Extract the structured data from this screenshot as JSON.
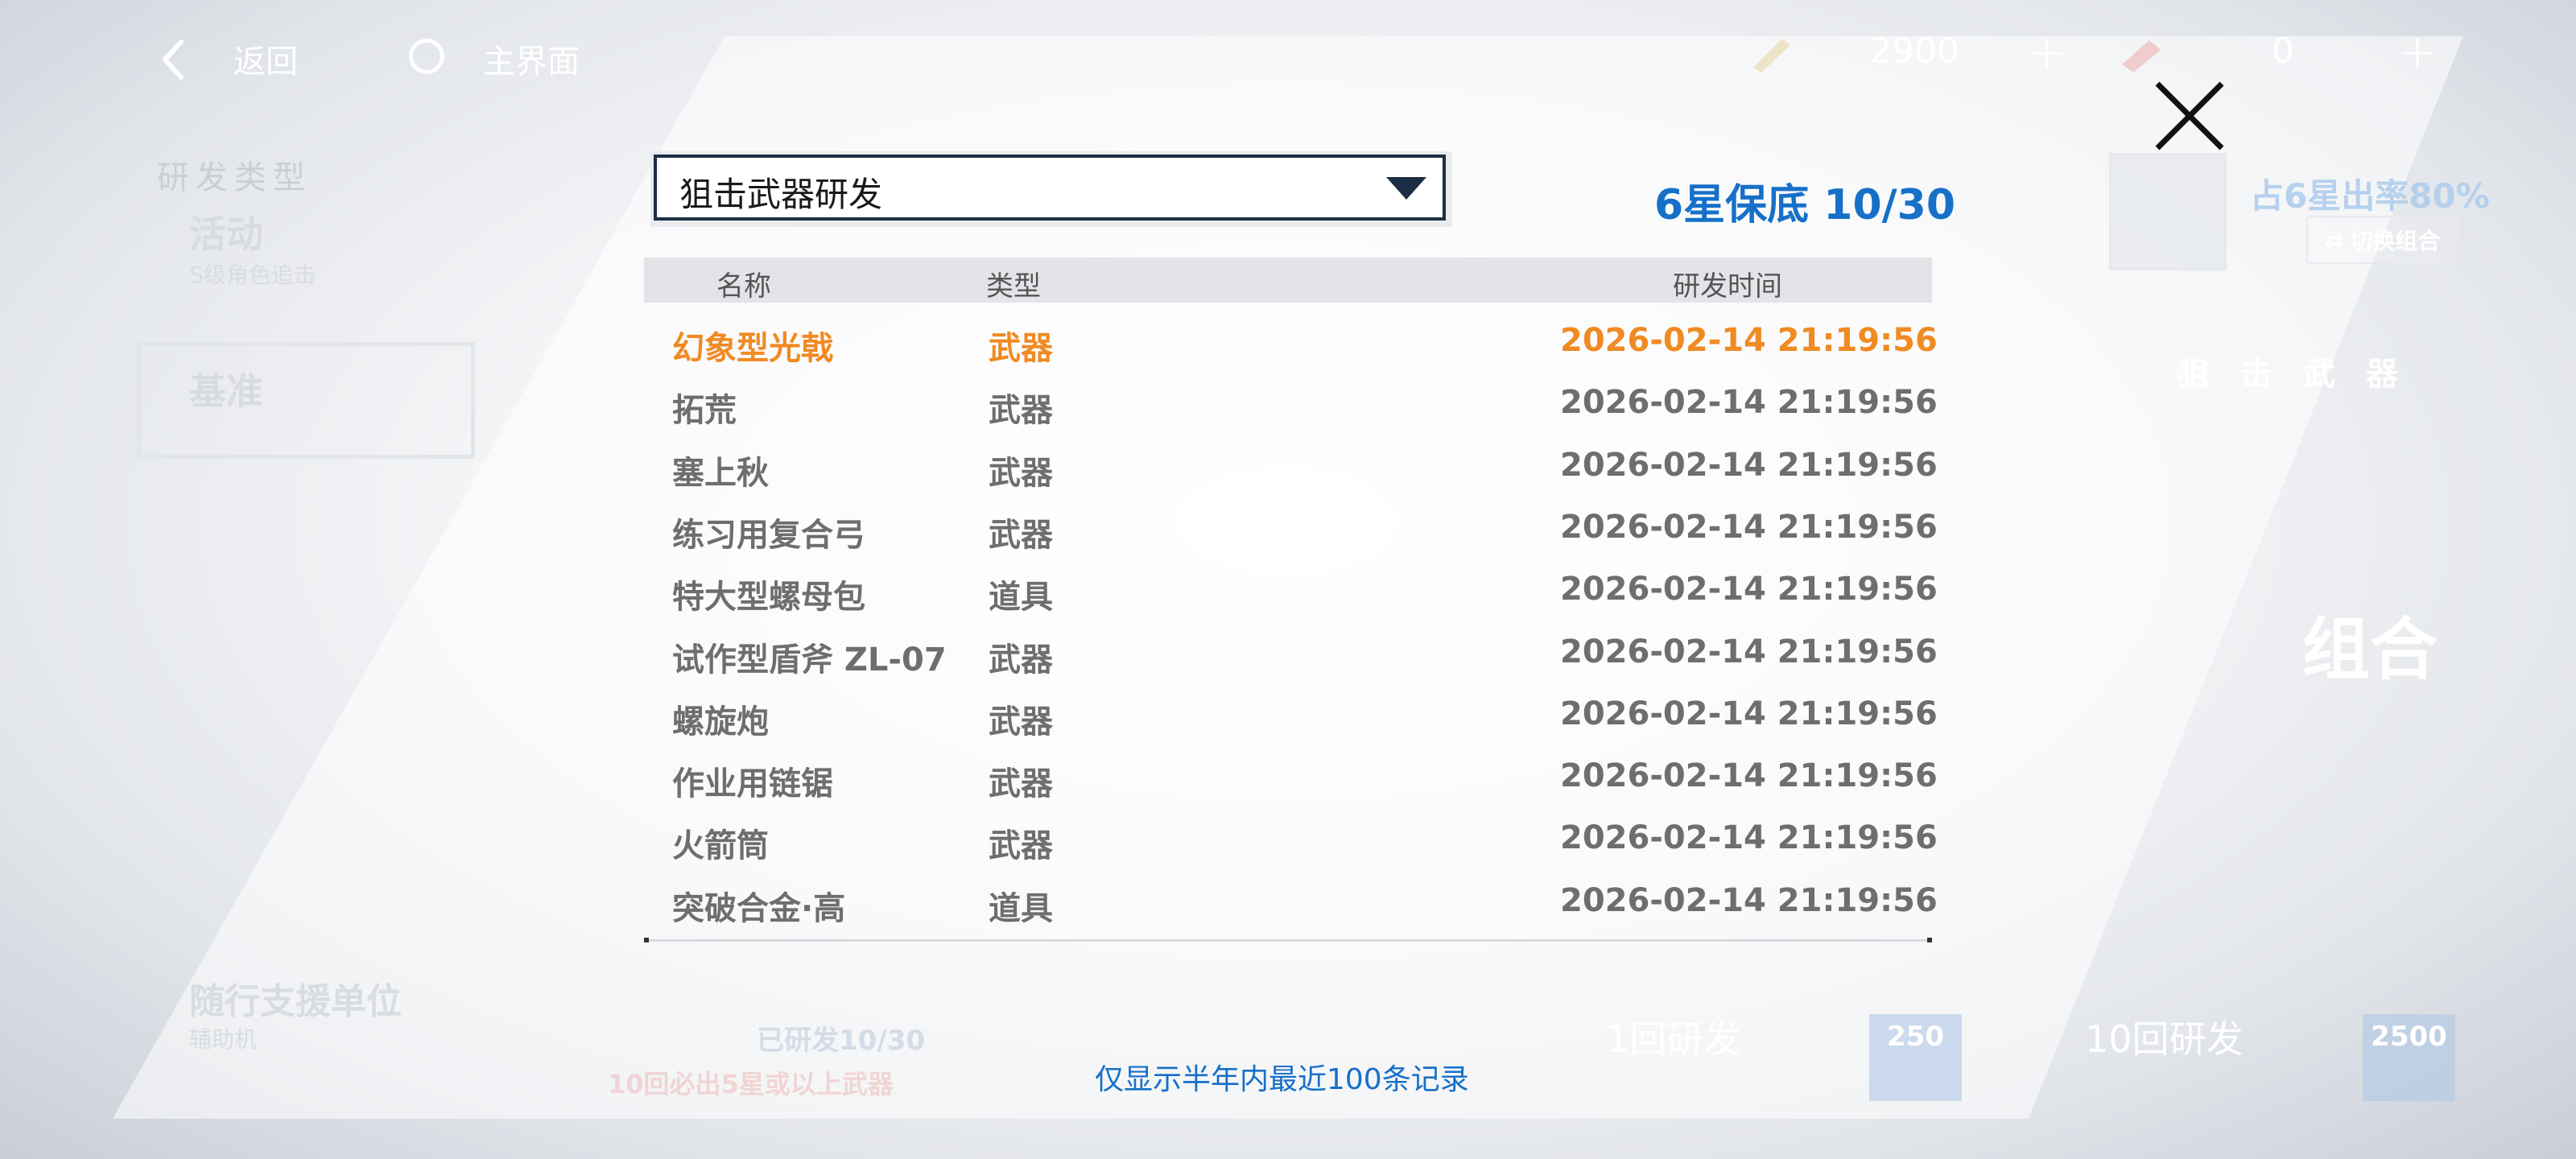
{
  "topbar": {
    "back_label": "返回",
    "home_label": "主界面",
    "currency1_value": "2900",
    "currency2_value": "0",
    "plus_glyph": "+"
  },
  "background": {
    "left": {
      "title": "研发类型",
      "item1_label": "活动",
      "item1_sub": "S级角色追击",
      "item2_label": "基准",
      "item5_label": "随行支援单位",
      "item5_sub": "辅助机"
    },
    "right": {
      "rate_text": "占6星出率80%",
      "switch_label": "切换组合",
      "weapon_label": "狙击武器",
      "big_text": "组合"
    },
    "bottom": {
      "researched": "已研发10/30",
      "guarantee": "10回必出5星或以上武器",
      "draw1_label": "1回研发",
      "draw1_cost": "250",
      "draw10_label": "10回研发",
      "draw10_cost": "2500"
    }
  },
  "dialog": {
    "select": {
      "selected": "狙击武器研发"
    },
    "pity_text": "6星保底 10/30",
    "table": {
      "headers": {
        "name": "名称",
        "type": "类型",
        "time": "研发时间"
      },
      "rows": [
        {
          "name": "幻象型光戟",
          "type": "武器",
          "time": "2026-02-14 21:19:56",
          "highlight": true
        },
        {
          "name": "拓荒",
          "type": "武器",
          "time": "2026-02-14 21:19:56",
          "highlight": false
        },
        {
          "name": "塞上秋",
          "type": "武器",
          "time": "2026-02-14 21:19:56",
          "highlight": false
        },
        {
          "name": "练习用复合弓",
          "type": "武器",
          "time": "2026-02-14 21:19:56",
          "highlight": false
        },
        {
          "name": "特大型螺母包",
          "type": "道具",
          "time": "2026-02-14 21:19:56",
          "highlight": false
        },
        {
          "name": "试作型盾斧 ZL-07",
          "type": "武器",
          "time": "2026-02-14 21:19:56",
          "highlight": false
        },
        {
          "name": "螺旋炮",
          "type": "武器",
          "time": "2026-02-14 21:19:56",
          "highlight": false
        },
        {
          "name": "作业用链锯",
          "type": "武器",
          "time": "2026-02-14 21:19:56",
          "highlight": false
        },
        {
          "name": "火箭筒",
          "type": "武器",
          "time": "2026-02-14 21:19:56",
          "highlight": false
        },
        {
          "name": "突破合金·高",
          "type": "道具",
          "time": "2026-02-14 21:19:56",
          "highlight": false
        }
      ]
    },
    "footer_note": "仅显示半年内最近100条记录"
  },
  "colors": {
    "accent_blue": "#1670c8",
    "highlight_orange": "#f08a22",
    "text_gray": "#6e6e6e",
    "select_border": "#1c2e44"
  },
  "icons": [
    "back-arrow-icon",
    "home-circle-icon",
    "pen-currency-icon",
    "ticket-currency-icon",
    "plus-icon",
    "close-icon",
    "dropdown-caret-icon",
    "switch-icon"
  ]
}
